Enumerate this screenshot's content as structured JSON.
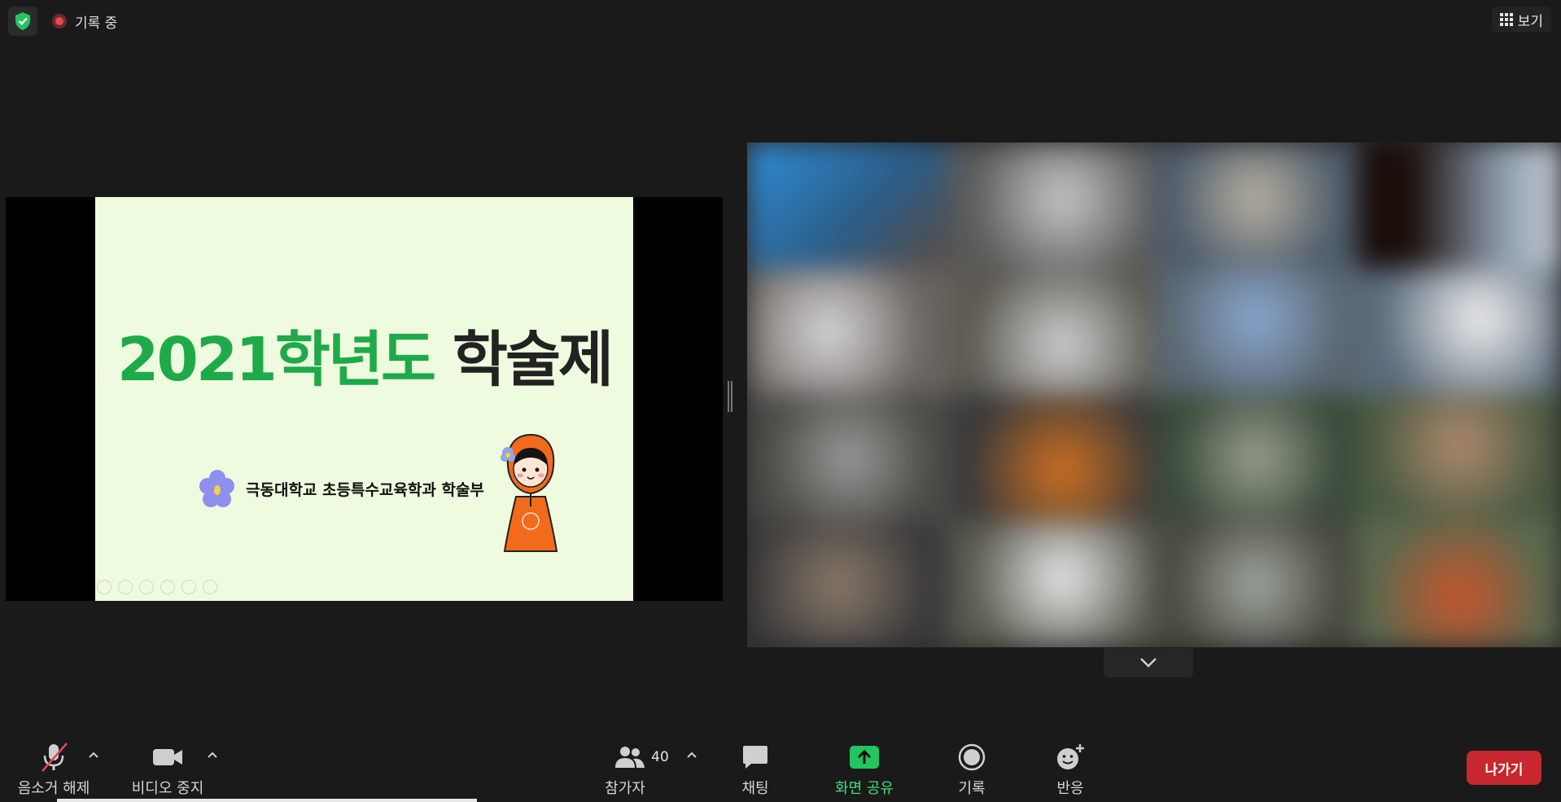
{
  "topbar": {
    "recording_label": "기록 중",
    "view_label": "보기"
  },
  "slide": {
    "title_year": "2021학년도",
    "title_rest": "학술제",
    "subtitle": "극동대학교 초등특수교육학과 학술부"
  },
  "toolbar": {
    "unmute_label": "음소거 해제",
    "stop_video_label": "비디오 중지",
    "participants_label": "참가자",
    "participants_count": "40",
    "chat_label": "채팅",
    "share_screen_label": "화면 공유",
    "record_label": "기록",
    "reactions_label": "반응",
    "leave_label": "나가기"
  },
  "colors": {
    "accent_green": "#1faa4a",
    "leave_red": "#c8272f",
    "share_green": "#22c55e"
  }
}
